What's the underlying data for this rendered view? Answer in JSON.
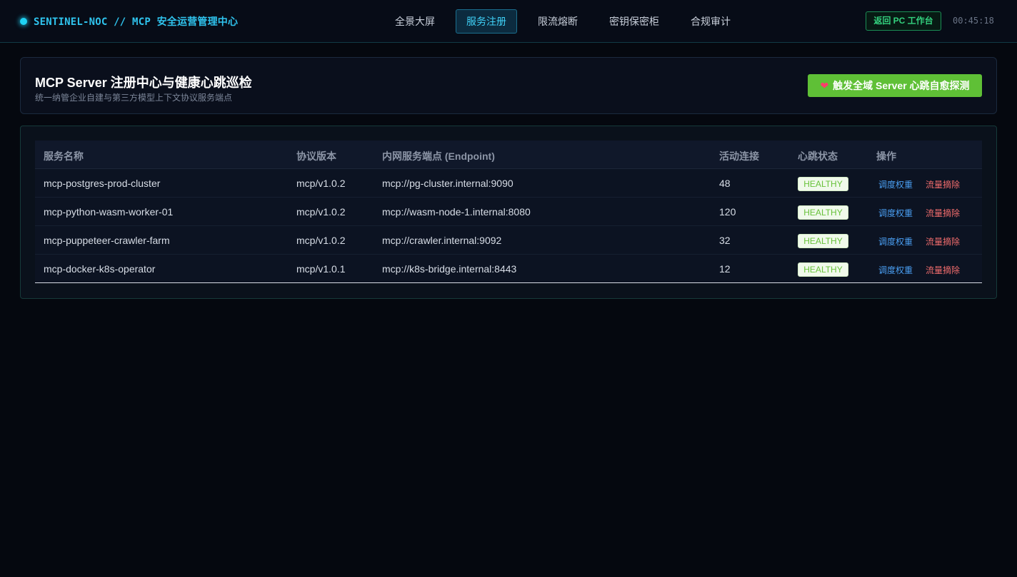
{
  "topbar": {
    "brand": "SENTINEL-NOC // MCP 安全运营管理中心",
    "nav": [
      {
        "label": "全景大屏",
        "active": false
      },
      {
        "label": "服务注册",
        "active": true
      },
      {
        "label": "限流熔断",
        "active": false
      },
      {
        "label": "密钥保密柜",
        "active": false
      },
      {
        "label": "合规审计",
        "active": false
      }
    ],
    "return_button": "返回 PC 工作台",
    "clock": "00:45:18"
  },
  "header": {
    "title": "MCP Server 注册中心与健康心跳巡检",
    "subtitle": "统一纳管企业自建与第三方模型上下文协议服务端点",
    "probe_button": "触发全域 Server 心跳自愈探测",
    "probe_icon": "heart-icon"
  },
  "table": {
    "columns": [
      "服务名称",
      "协议版本",
      "内网服务端点 (Endpoint)",
      "活动连接",
      "心跳状态",
      "操作"
    ],
    "rows": [
      {
        "name": "mcp-postgres-prod-cluster",
        "version": "mcp/v1.0.2",
        "endpoint": "mcp://pg-cluster.internal:9090",
        "connections": "48",
        "status": "HEALTHY",
        "op_weight": "调度权重",
        "op_drain": "流量摘除"
      },
      {
        "name": "mcp-python-wasm-worker-01",
        "version": "mcp/v1.0.2",
        "endpoint": "mcp://wasm-node-1.internal:8080",
        "connections": "120",
        "status": "HEALTHY",
        "op_weight": "调度权重",
        "op_drain": "流量摘除"
      },
      {
        "name": "mcp-puppeteer-crawler-farm",
        "version": "mcp/v1.0.2",
        "endpoint": "mcp://crawler.internal:9092",
        "connections": "32",
        "status": "HEALTHY",
        "op_weight": "调度权重",
        "op_drain": "流量摘除"
      },
      {
        "name": "mcp-docker-k8s-operator",
        "version": "mcp/v1.0.1",
        "endpoint": "mcp://k8s-bridge.internal:8443",
        "connections": "12",
        "status": "HEALTHY",
        "op_weight": "调度权重",
        "op_drain": "流量摘除"
      }
    ]
  },
  "colors": {
    "accent": "#2fc4ee",
    "healthy": "#68c23a",
    "primary_action": "#5fc036",
    "danger": "#f26d6d",
    "link": "#4a9ff3"
  }
}
